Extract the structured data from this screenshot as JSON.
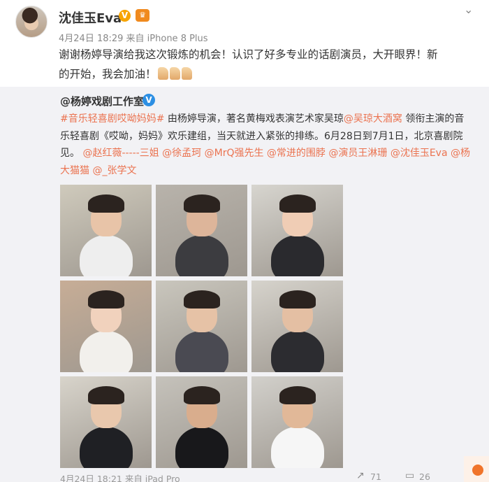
{
  "post": {
    "username": "沈佳玉Eva",
    "verified_badge": "V",
    "vip_badge": "♛",
    "timestamp": "4月24日 18:29 来自 iPhone 8 Plus",
    "text_part1": "谢谢杨婷导演给我这次锻炼的机会！认识了好多专业的话剧演员，大开眼界！新",
    "text_part2": "的开始，我会加油！"
  },
  "repost": {
    "author": "@杨婷戏剧工作室",
    "author_verified_badge": "V",
    "hashtag": "#音乐轻喜剧哎呦妈妈#",
    "text1": " 由杨婷导演，著名黄梅戏表演艺术家吴琼",
    "mention_wuqiong": "@吴琼大酒窝",
    "text2": " 领衔主演的音乐轻喜剧《哎呦，妈妈》欢乐建组，当天就进入紧张的排练。6月28日到7月1日，北京喜剧院见。",
    "mentions": [
      "@赵红薇-----三姐",
      "@徐孟珂",
      "@MrQ强先生",
      "@常进的围脖",
      "@演员王淋珊",
      "@沈佳玉Eva",
      "@杨大猫猫",
      "@_张学文"
    ],
    "photos": [
      {
        "name": "photo-1",
        "bg": "#cfcabc",
        "skin": "#e8c4a8",
        "shirt": "#eeeeee"
      },
      {
        "name": "photo-2",
        "bg": "#b8b3ab",
        "skin": "#ddb59a",
        "shirt": "#3c3c40"
      },
      {
        "name": "photo-3",
        "bg": "#d7d5cf",
        "skin": "#f0cdb5",
        "shirt": "#2a2a2e"
      },
      {
        "name": "photo-4",
        "bg": "#c7ad96",
        "skin": "#f1d2bd",
        "shirt": "#f2f0ec"
      },
      {
        "name": "photo-5",
        "bg": "#c9c6bd",
        "skin": "#e6c2a6",
        "shirt": "#4a4a52"
      },
      {
        "name": "photo-6",
        "bg": "#d6d3cc",
        "skin": "#e4bfa3",
        "shirt": "#2c2c30"
      },
      {
        "name": "photo-7",
        "bg": "#d8d4cb",
        "skin": "#e9c8ad",
        "shirt": "#1f2024"
      },
      {
        "name": "photo-8",
        "bg": "#c5c2bb",
        "skin": "#d9ad8d",
        "shirt": "#18181b"
      },
      {
        "name": "photo-9",
        "bg": "#d2d0cb",
        "skin": "#e1b898",
        "shirt": "#f6f6f6"
      }
    ],
    "footer_time": "4月24日 18:21 来自 iPad Pro",
    "share_count": "71",
    "comment_count": "26"
  },
  "colors": {
    "link": "#eb7350",
    "repost_bg": "#f2f2f5",
    "verified_blue": "#2d8fe3",
    "verified_gold": "#f7a400"
  }
}
